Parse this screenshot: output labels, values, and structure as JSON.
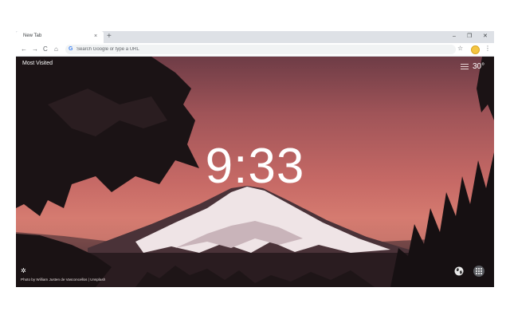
{
  "tab": {
    "title": "New Tab",
    "close": "×",
    "new_tab": "+"
  },
  "window": {
    "minimize": "–",
    "restore": "❐",
    "close": "✕"
  },
  "toolbar": {
    "back": "←",
    "forward": "→",
    "reload": "C",
    "home": "⌂",
    "omnibox_placeholder": "Search Google or type a URL",
    "star": "☆",
    "menu": "⋮"
  },
  "page": {
    "most_visited": "Most Visited",
    "temperature": "30°",
    "clock": "9:33",
    "photo_credit": "Photo by William Justen de Vasconcellos | Unsplash"
  },
  "colors": {
    "sky_top": "#6e3c46",
    "sky_glow": "#d57b70",
    "foreground": "#1f1618"
  }
}
